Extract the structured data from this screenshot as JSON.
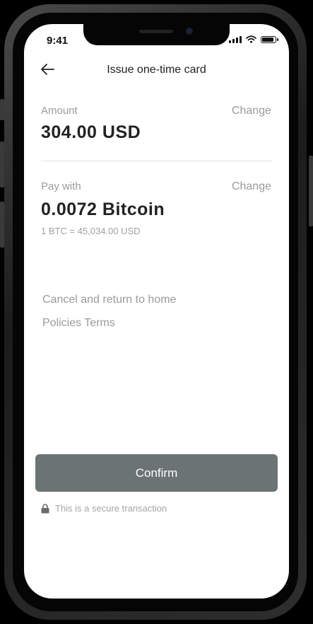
{
  "status_bar": {
    "time": "9:41"
  },
  "header": {
    "title": "Issue one-time card",
    "back_icon": "arrow-left-icon"
  },
  "amount": {
    "label": "Amount",
    "change_label": "Change",
    "value": "304.00 USD"
  },
  "pay_with": {
    "label": "Pay with",
    "change_label": "Change",
    "value": "0.0072 Bitcoin",
    "rate": "1 BTC = 45,034.00 USD"
  },
  "links": {
    "cancel": "Cancel and return to home",
    "policies": "Policies",
    "terms": "Terms"
  },
  "confirm": {
    "label": "Confirm"
  },
  "secure_note": {
    "text": "This is a secure transaction",
    "icon": "lock-icon"
  },
  "colors": {
    "confirm_bg": "#6b7373",
    "muted_text": "#9a9a9a",
    "primary_text": "#222222"
  }
}
